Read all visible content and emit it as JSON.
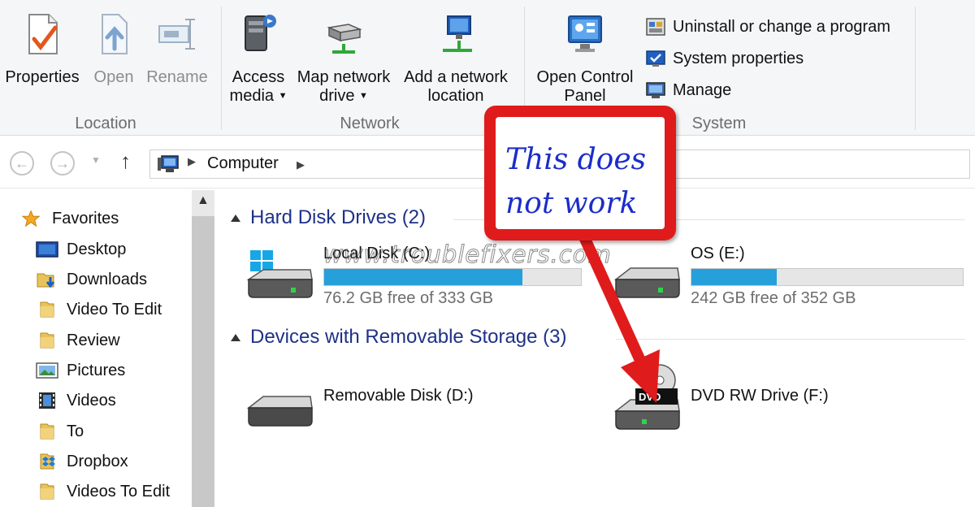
{
  "ribbon": {
    "groups": {
      "location": "Location",
      "network": "Network",
      "system": "System"
    },
    "buttons": {
      "properties": "Properties",
      "open": "Open",
      "rename": "Rename",
      "access_media_1": "Access",
      "access_media_2": "media",
      "map_drive_1": "Map network",
      "map_drive_2": "drive",
      "add_location_1": "Add a network",
      "add_location_2": "location",
      "control_panel_1": "Open Control",
      "control_panel_2": "Panel"
    },
    "system_items": {
      "uninstall": "Uninstall or change a program",
      "sysprops": "System properties",
      "manage": "Manage"
    }
  },
  "address": {
    "crumb": "Computer"
  },
  "nav": {
    "items": [
      "Favorites",
      "Desktop",
      "Downloads",
      "Video To Edit",
      "Review",
      "Pictures",
      "Videos",
      "To",
      "Dropbox",
      "Videos To Edit"
    ]
  },
  "content": {
    "hdd_header": "Hard Disk Drives (2)",
    "removable_header": "Devices with Removable Storage (3)",
    "drives": {
      "c": {
        "name": "Local Disk (C:)",
        "free": "76.2 GB free of 333 GB",
        "used_fraction": 0.771
      },
      "e": {
        "name": "OS (E:)",
        "free": "242 GB free of 352 GB",
        "used_fraction": 0.313
      },
      "d": {
        "name": "Removable Disk (D:)"
      },
      "f": {
        "name": "DVD RW Drive (F:)",
        "badge": "DVD"
      }
    }
  },
  "annotation": {
    "line1": "This does",
    "line2": "not work",
    "watermark": "www.troublefixers.com"
  },
  "colors": {
    "accent_bar": "#26a0da",
    "callout_red": "#e01b1b",
    "callout_text": "#1b2dc9",
    "header_blue": "#1e3287"
  }
}
